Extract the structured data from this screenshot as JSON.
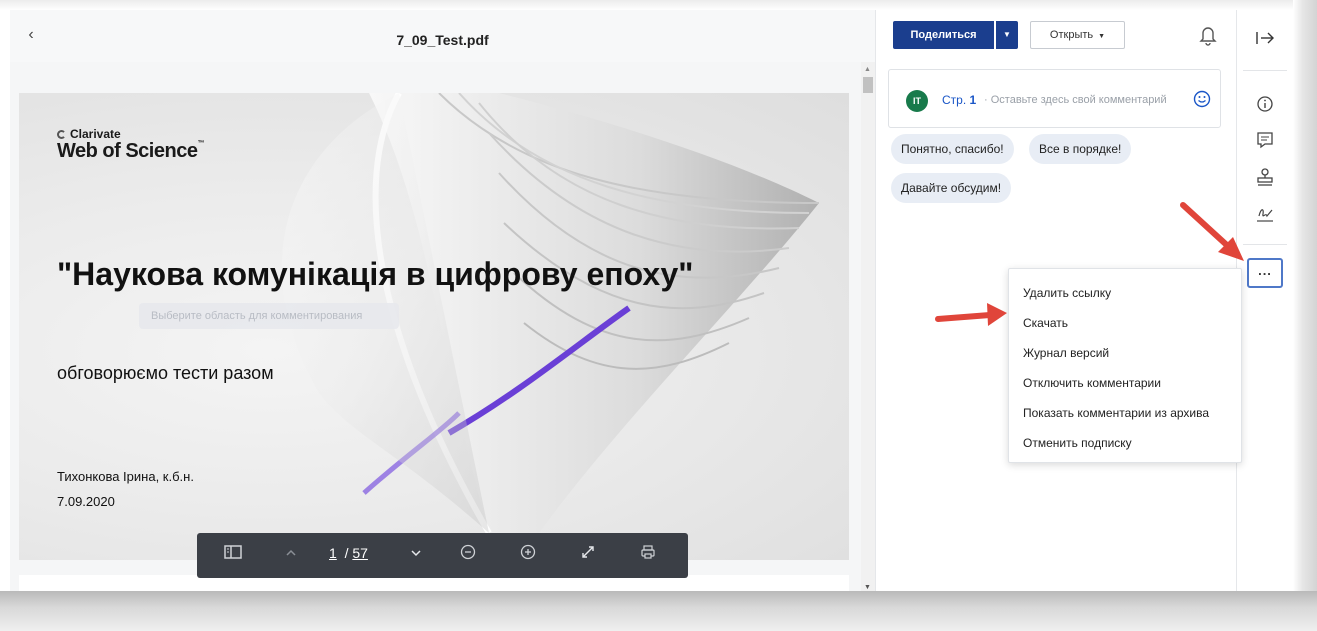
{
  "viewer": {
    "title": "7_09_Test.pdf",
    "slide": {
      "brand_top": "Clarivate",
      "brand_main": "Web of Science",
      "brand_tm": "™",
      "title": "\"Наукова комунікація в цифрову епоху\"",
      "hint": "Выберите область для комментирования",
      "subtitle": "обговорюємо тести разом",
      "author": "Тихонкова Ірина, к.б.н.",
      "date": "7.09.2020"
    },
    "toolbar": {
      "current_page": "1",
      "total_pages": "57"
    }
  },
  "panel": {
    "share_label": "Поделиться",
    "open_label": "Открыть",
    "comment": {
      "avatar_initials": "IT",
      "page_prefix": "Стр.",
      "page_number": "1",
      "separator": "·",
      "placeholder": "Оставьте здесь свой комментарий"
    },
    "quick_replies": [
      "Понятно, спасибо!",
      "Все в порядке!",
      "Давайте обсудим!"
    ]
  },
  "menu": {
    "items": [
      "Удалить ссылку",
      "Скачать",
      "Журнал версий",
      "Отключить комментарии",
      "Показать комментарии из архива",
      "Отменить подписку"
    ]
  },
  "rail": {
    "more_label": "..."
  },
  "colors": {
    "share_button": "#1b3e8e",
    "avatar": "#187a4b",
    "link": "#1a56c7",
    "annotation_arrow": "#e0453a",
    "slide_accent": "#6a3fd6"
  }
}
